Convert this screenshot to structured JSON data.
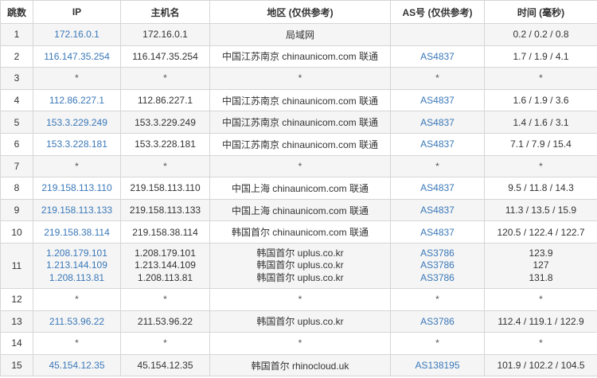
{
  "headers": {
    "hop": "跳数",
    "ip": "IP",
    "host": "主机名",
    "region": "地区 (仅供参考)",
    "asn": "AS号 (仅供参考)",
    "time": "时间 (毫秒)"
  },
  "rows": [
    {
      "hop": "1",
      "ip": [
        "172.16.0.1"
      ],
      "host": [
        "172.16.0.1"
      ],
      "region": [
        "局域网"
      ],
      "asn": [
        ""
      ],
      "time": [
        "0.2 / 0.2 / 0.8"
      ]
    },
    {
      "hop": "2",
      "ip": [
        "116.147.35.254"
      ],
      "host": [
        "116.147.35.254"
      ],
      "region": [
        "中国江苏南京 chinaunicom.com 联通"
      ],
      "asn": [
        "AS4837"
      ],
      "time": [
        "1.7 / 1.9 / 4.1"
      ]
    },
    {
      "hop": "3",
      "ip": [
        "*"
      ],
      "host": [
        "*"
      ],
      "region": [
        "*"
      ],
      "asn": [
        "*"
      ],
      "time": [
        "*"
      ]
    },
    {
      "hop": "4",
      "ip": [
        "112.86.227.1"
      ],
      "host": [
        "112.86.227.1"
      ],
      "region": [
        "中国江苏南京 chinaunicom.com 联通"
      ],
      "asn": [
        "AS4837"
      ],
      "time": [
        "1.6 / 1.9 / 3.6"
      ]
    },
    {
      "hop": "5",
      "ip": [
        "153.3.229.249"
      ],
      "host": [
        "153.3.229.249"
      ],
      "region": [
        "中国江苏南京 chinaunicom.com 联通"
      ],
      "asn": [
        "AS4837"
      ],
      "time": [
        "1.4 / 1.6 / 3.1"
      ]
    },
    {
      "hop": "6",
      "ip": [
        "153.3.228.181"
      ],
      "host": [
        "153.3.228.181"
      ],
      "region": [
        "中国江苏南京 chinaunicom.com 联通"
      ],
      "asn": [
        "AS4837"
      ],
      "time": [
        "7.1 / 7.9 / 15.4"
      ]
    },
    {
      "hop": "7",
      "ip": [
        "*"
      ],
      "host": [
        "*"
      ],
      "region": [
        "*"
      ],
      "asn": [
        "*"
      ],
      "time": [
        "*"
      ]
    },
    {
      "hop": "8",
      "ip": [
        "219.158.113.110"
      ],
      "host": [
        "219.158.113.110"
      ],
      "region": [
        "中国上海 chinaunicom.com 联通"
      ],
      "asn": [
        "AS4837"
      ],
      "time": [
        "9.5 / 11.8 / 14.3"
      ]
    },
    {
      "hop": "9",
      "ip": [
        "219.158.113.133"
      ],
      "host": [
        "219.158.113.133"
      ],
      "region": [
        "中国上海 chinaunicom.com 联通"
      ],
      "asn": [
        "AS4837"
      ],
      "time": [
        "11.3 / 13.5 / 15.9"
      ]
    },
    {
      "hop": "10",
      "ip": [
        "219.158.38.114"
      ],
      "host": [
        "219.158.38.114"
      ],
      "region": [
        "韩国首尔 chinaunicom.com 联通"
      ],
      "asn": [
        "AS4837"
      ],
      "time": [
        "120.5 / 122.4 / 122.7"
      ]
    },
    {
      "hop": "11",
      "ip": [
        "1.208.179.101",
        "1.213.144.109",
        "1.208.113.81"
      ],
      "host": [
        "1.208.179.101",
        "1.213.144.109",
        "1.208.113.81"
      ],
      "region": [
        "韩国首尔 uplus.co.kr",
        "韩国首尔 uplus.co.kr",
        "韩国首尔 uplus.co.kr"
      ],
      "asn": [
        "AS3786",
        "AS3786",
        "AS3786"
      ],
      "time": [
        "123.9",
        "127",
        "131.8"
      ]
    },
    {
      "hop": "12",
      "ip": [
        "*"
      ],
      "host": [
        "*"
      ],
      "region": [
        "*"
      ],
      "asn": [
        "*"
      ],
      "time": [
        "*"
      ]
    },
    {
      "hop": "13",
      "ip": [
        "211.53.96.22"
      ],
      "host": [
        "211.53.96.22"
      ],
      "region": [
        "韩国首尔 uplus.co.kr"
      ],
      "asn": [
        "AS3786"
      ],
      "time": [
        "112.4 / 119.1 / 122.9"
      ]
    },
    {
      "hop": "14",
      "ip": [
        "*"
      ],
      "host": [
        "*"
      ],
      "region": [
        "*"
      ],
      "asn": [
        "*"
      ],
      "time": [
        "*"
      ]
    },
    {
      "hop": "15",
      "ip": [
        "45.154.12.35"
      ],
      "host": [
        "45.154.12.35"
      ],
      "region": [
        "韩国首尔 rhinocloud.uk"
      ],
      "asn": [
        "AS138195"
      ],
      "time": [
        "101.9 / 102.2 / 104.5"
      ]
    }
  ],
  "colors": {
    "link": "#3a78b8",
    "stripe": "#f5f5f5",
    "border": "#d6d6d6"
  }
}
